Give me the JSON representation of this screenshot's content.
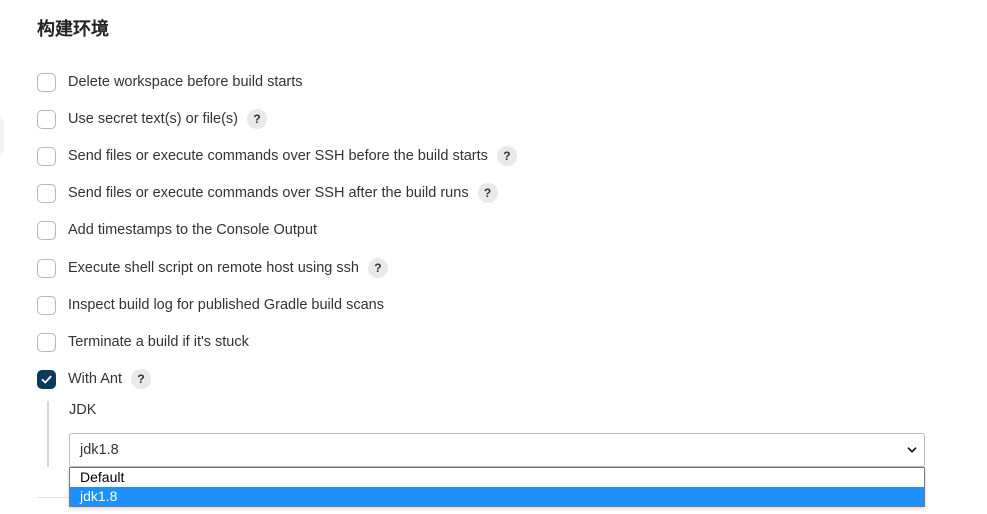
{
  "section": {
    "title": "构建环境"
  },
  "options": [
    {
      "label": "Delete workspace before build starts",
      "checked": false,
      "help": false
    },
    {
      "label": "Use secret text(s) or file(s)",
      "checked": false,
      "help": true
    },
    {
      "label": "Send files or execute commands over SSH before the build starts",
      "checked": false,
      "help": true
    },
    {
      "label": "Send files or execute commands over SSH after the build runs",
      "checked": false,
      "help": true
    },
    {
      "label": "Add timestamps to the Console Output",
      "checked": false,
      "help": false
    },
    {
      "label": "Execute shell script on remote host using ssh",
      "checked": false,
      "help": true
    },
    {
      "label": "Inspect build log for published Gradle build scans",
      "checked": false,
      "help": false
    },
    {
      "label": "Terminate a build if it's stuck",
      "checked": false,
      "help": false
    },
    {
      "label": "With Ant",
      "checked": true,
      "help": true
    }
  ],
  "help_glyph": "?",
  "ant": {
    "jdk_label": "JDK",
    "jdk_selected": "jdk1.8",
    "jdk_options": [
      "Default",
      "jdk1.8"
    ]
  },
  "colors": {
    "checkbox_checked": "#0b3a5b",
    "dropdown_highlight": "#1e90ff"
  },
  "icons": {
    "help": "question-mark-icon",
    "check": "checkmark-icon",
    "select_arrow": "chevron-down-icon"
  }
}
